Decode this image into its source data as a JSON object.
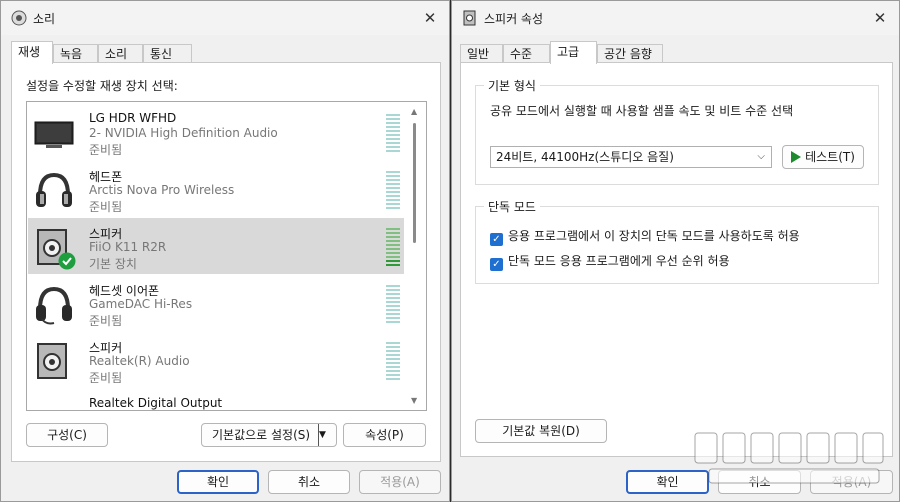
{
  "sound_window": {
    "title": "소리",
    "tabs": [
      "재생",
      "녹음",
      "소리",
      "통신"
    ],
    "prompt": "설정을 수정할 재생 장치 선택:",
    "devices": [
      {
        "name": "LG HDR WFHD",
        "desc": "2- NVIDIA High Definition Audio",
        "status": "준비됨",
        "icon": "monitor-icon",
        "default": false
      },
      {
        "name": "헤드폰",
        "desc": "Arctis Nova Pro Wireless",
        "status": "준비됨",
        "icon": "headphones-icon",
        "default": false
      },
      {
        "name": "스피커",
        "desc": "FiiO K11 R2R",
        "status": "기본 장치",
        "icon": "speaker-icon",
        "default": true
      },
      {
        "name": "헤드셋 이어폰",
        "desc": "GameDAC Hi-Res",
        "status": "준비됨",
        "icon": "headset-icon",
        "default": false
      },
      {
        "name": "스피커",
        "desc": "Realtek(R) Audio",
        "status": "준비됨",
        "icon": "speaker-icon",
        "default": false
      },
      {
        "name": "Realtek Digital Output",
        "desc": "",
        "status": "",
        "icon": "speaker-icon",
        "default": false
      }
    ],
    "configure_label": "구성(C)",
    "set_default_label": "기본값으로 설정(S)",
    "properties_label": "속성(P)",
    "ok_label": "확인",
    "cancel_label": "취소",
    "apply_label": "적용(A)"
  },
  "properties_window": {
    "title": "스피커 속성",
    "tabs": [
      "일반",
      "수준",
      "고급",
      "공간 음향"
    ],
    "default_format": {
      "title": "기본 형식",
      "description": "공유 모드에서 실행할 때 사용할 샘플 속도 및 비트 수준 선택",
      "selected_format": "24비트, 44100Hz(스튜디오 음질)",
      "test_label": "테스트(T)"
    },
    "exclusive_mode": {
      "title": "단독 모드",
      "options": [
        {
          "label": "응용 프로그램에서 이 장치의 단독 모드를 사용하도록 허용",
          "checked": true
        },
        {
          "label": "단독 모드 응용 프로그램에게 우선 순위 허용",
          "checked": true
        }
      ]
    },
    "restore_defaults_label": "기본값 복원(D)",
    "ok_label": "확인",
    "cancel_label": "취소",
    "apply_label": "적용(A)"
  },
  "colors": {
    "accent": "#2b63c9",
    "checkbox": "#1f6fd0",
    "default_check": "#1e9e3e",
    "meter_active": "#2e9a3a"
  }
}
